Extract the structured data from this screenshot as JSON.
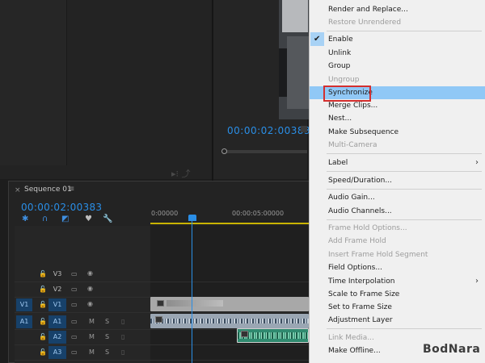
{
  "program_monitor": {
    "timecode": "00:00:02:00383"
  },
  "sequence": {
    "close_glyph": "×",
    "name": "Sequence 01",
    "menu_glyph": "≡",
    "timecode": "00:00:02:00383",
    "ruler_labels": [
      "0:00000",
      "00:00:05:00000"
    ]
  },
  "tracks": [
    {
      "name": "V3",
      "source": "",
      "icons": [
        "lock-icon",
        "film-icon",
        "eye-icon"
      ]
    },
    {
      "name": "V2",
      "source": "",
      "icons": [
        "lock-icon",
        "film-icon",
        "eye-icon"
      ]
    },
    {
      "name": "V1",
      "source": "V1",
      "icons": [
        "lock-icon",
        "film-icon",
        "eye-icon"
      ]
    },
    {
      "name": "A1",
      "source": "A1",
      "icons": [
        "lock-icon",
        "film-icon",
        "M",
        "S",
        "mic-icon"
      ]
    },
    {
      "name": "A2",
      "source": "",
      "icons": [
        "lock-icon",
        "film-icon",
        "M",
        "S",
        "mic-icon"
      ]
    },
    {
      "name": "A3",
      "source": "",
      "icons": [
        "lock-icon",
        "film-icon",
        "M",
        "S",
        "mic-icon"
      ]
    }
  ],
  "track_letters": {
    "m": "M",
    "s": "S"
  },
  "context_menu": {
    "items": [
      {
        "label": "Render and Replace...",
        "enabled": true
      },
      {
        "label": "Restore Unrendered",
        "enabled": false
      },
      {
        "label": "Enable",
        "enabled": true,
        "checked": true
      },
      {
        "label": "Unlink",
        "enabled": true
      },
      {
        "label": "Group",
        "enabled": true
      },
      {
        "label": "Ungroup",
        "enabled": false
      },
      {
        "label": "Synchronize",
        "enabled": true,
        "highlighted": true
      },
      {
        "label": "Merge Clips...",
        "enabled": true
      },
      {
        "label": "Nest...",
        "enabled": true
      },
      {
        "label": "Make Subsequence",
        "enabled": true
      },
      {
        "label": "Multi-Camera",
        "enabled": false,
        "submenu": true
      },
      {
        "label": "Label",
        "enabled": true,
        "submenu": true
      },
      {
        "label": "Speed/Duration...",
        "enabled": true
      },
      {
        "label": "Audio Gain...",
        "enabled": true
      },
      {
        "label": "Audio Channels...",
        "enabled": true
      },
      {
        "label": "Frame Hold Options...",
        "enabled": false
      },
      {
        "label": "Add Frame Hold",
        "enabled": false
      },
      {
        "label": "Insert Frame Hold Segment",
        "enabled": false
      },
      {
        "label": "Field Options...",
        "enabled": true
      },
      {
        "label": "Time Interpolation",
        "enabled": true,
        "submenu": true
      },
      {
        "label": "Scale to Frame Size",
        "enabled": true
      },
      {
        "label": "Set to Frame Size",
        "enabled": true
      },
      {
        "label": "Adjustment Layer",
        "enabled": true
      },
      {
        "label": "Link Media...",
        "enabled": false
      },
      {
        "label": "Make Offline...",
        "enabled": true
      }
    ],
    "check_glyph": "✔",
    "arrow_glyph": "›"
  },
  "watermark": "BodNara",
  "colors": {
    "accent_blue": "#2a8ee6",
    "menu_highlight": "#90c8f6",
    "callout_red": "#d32f2f",
    "audio_clip_green": "#2f8a6f"
  }
}
